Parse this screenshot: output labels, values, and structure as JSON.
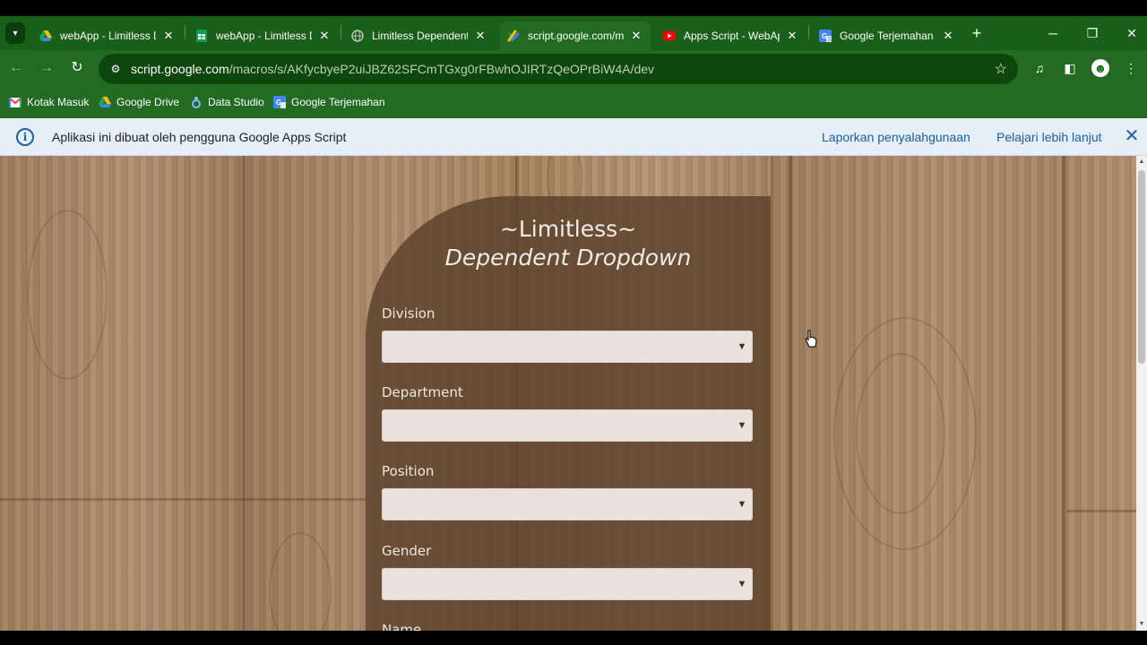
{
  "tabs": [
    {
      "title": "webApp - Limitless D",
      "icon": "google-drive-icon",
      "active": false
    },
    {
      "title": "webApp - Limitless D",
      "icon": "google-sheets-icon",
      "active": false
    },
    {
      "title": "Limitless Dependent I",
      "icon": "globe-icon",
      "active": false
    },
    {
      "title": "script.google.com/m",
      "icon": "apps-script-icon",
      "active": true
    },
    {
      "title": "Apps Script - WebAp",
      "icon": "youtube-icon",
      "active": false
    },
    {
      "title": "Google Terjemahan",
      "icon": "google-translate-icon",
      "active": false
    }
  ],
  "address": {
    "host": "script.google.com",
    "path": "/macros/s/AKfycbyeP2uiJBZ62SFCmTGxg0rFBwhOJIRTzQeOPrBiW4A/dev"
  },
  "bookmarks": [
    {
      "label": "Kotak Masuk",
      "icon": "gmail-icon"
    },
    {
      "label": "Google Drive",
      "icon": "google-drive-icon"
    },
    {
      "label": "Data Studio",
      "icon": "data-studio-icon"
    },
    {
      "label": "Google Terjemahan",
      "icon": "google-translate-icon"
    }
  ],
  "infobar": {
    "message": "Aplikasi ini dibuat oleh pengguna Google Apps Script",
    "report_link": "Laporkan penyalahgunaan",
    "learn_link": "Pelajari lebih lanjut"
  },
  "form": {
    "title_line1": "~Limitless~",
    "title_line2": "Dependent Dropdown",
    "fields": [
      {
        "label": "Division",
        "value": ""
      },
      {
        "label": "Department",
        "value": ""
      },
      {
        "label": "Position",
        "value": ""
      },
      {
        "label": "Gender",
        "value": ""
      },
      {
        "label": "Name",
        "value": ""
      }
    ]
  },
  "colors": {
    "chrome_green": "#236b23",
    "tabbar_green": "#1a5f1a",
    "info_blue": "#1a5fa8",
    "card_brown": "#583e2b"
  }
}
